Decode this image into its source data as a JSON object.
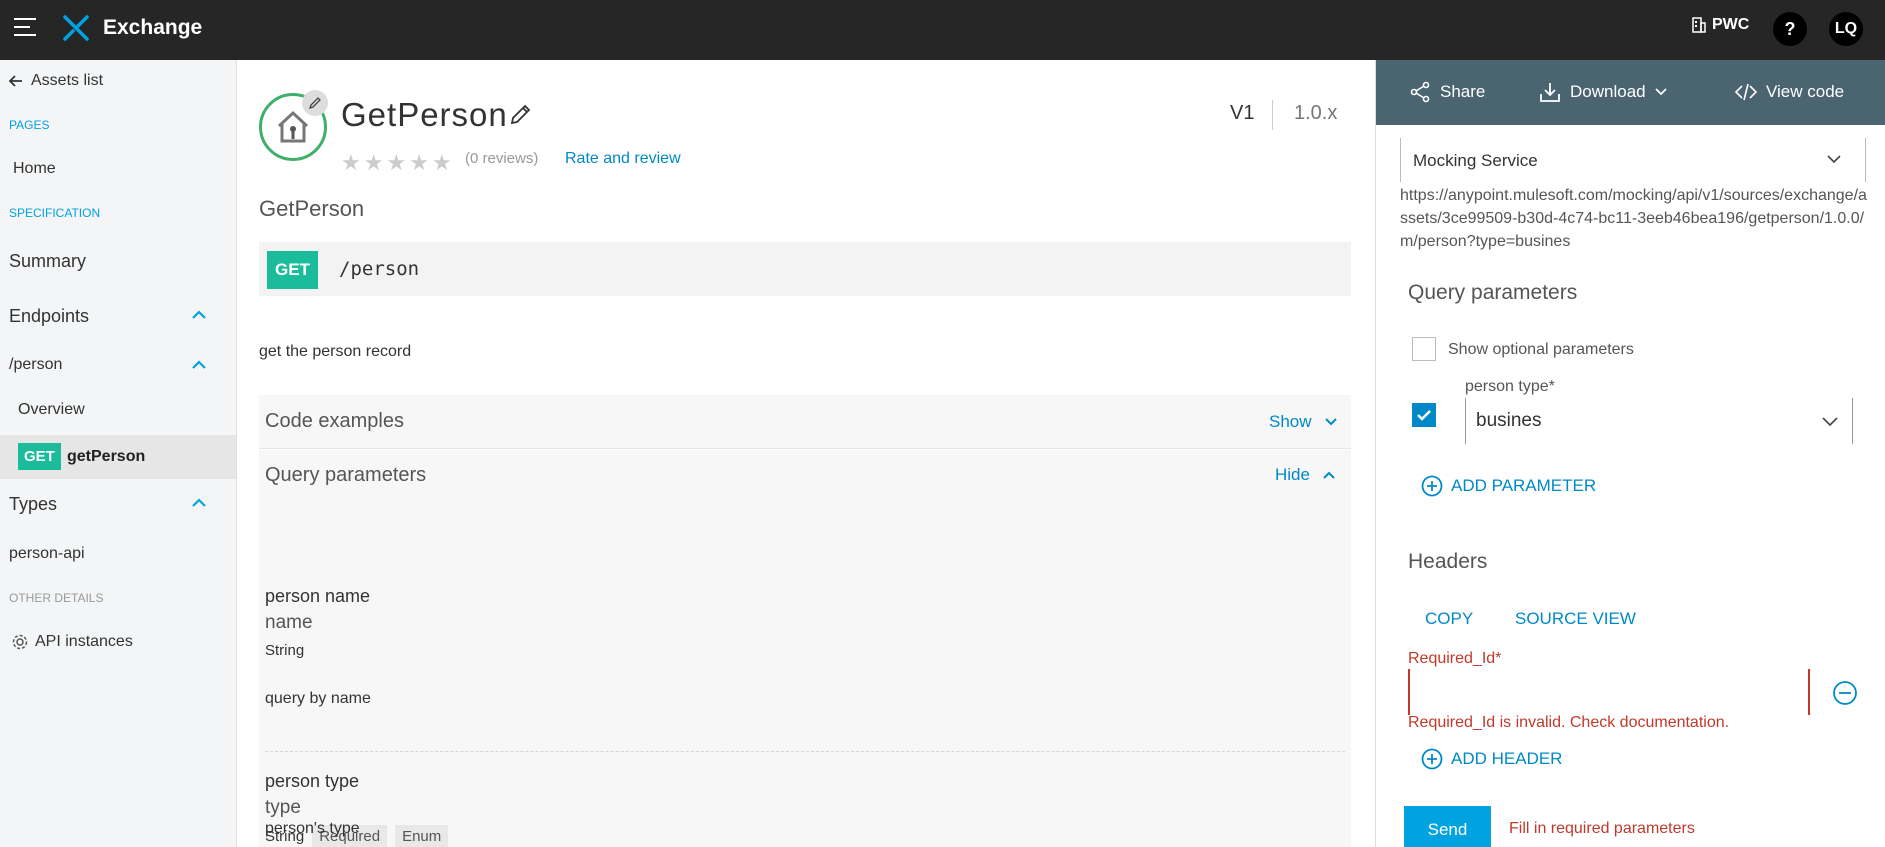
{
  "topbar": {
    "brand": "Exchange",
    "org": "PWC",
    "help": "?",
    "avatar": "LQ",
    "icons": {
      "menu": "hamburger-icon",
      "logo": "exchange-logo-icon",
      "org": "building-icon"
    }
  },
  "sidebar": {
    "back_label": "Assets list",
    "section_pages": "PAGES",
    "home": "Home",
    "section_spec": "SPECIFICATION",
    "summary": "Summary",
    "endpoints": "Endpoints",
    "person_path": "/person",
    "overview": "Overview",
    "method": "GET",
    "get_person": "getPerson",
    "types": "Types",
    "person_api": "person-api",
    "section_other": "OTHER DETAILS",
    "api_instances": "API instances"
  },
  "main": {
    "title": "GetPerson",
    "reviews": "(0 reviews)",
    "rate_link": "Rate and review",
    "version_major": "V1",
    "version_minor": "1.0.x",
    "heading": "GetPerson",
    "method": "GET",
    "path": "/person",
    "description": "get the person record",
    "code_examples": {
      "title": "Code examples",
      "toggle": "Show"
    },
    "query_params": {
      "title": "Query parameters",
      "toggle": "Hide"
    },
    "params": [
      {
        "name": "person name",
        "key": "name",
        "type": "String",
        "tags": [],
        "description": "query by name"
      },
      {
        "name": "person type",
        "key": "type",
        "type": "String",
        "tags": [
          "Required",
          "Enum"
        ],
        "description": "person's type"
      }
    ]
  },
  "console": {
    "toolbar": {
      "share": "Share",
      "download": "Download",
      "view_code": "View code"
    },
    "mock_service": "Mocking Service",
    "mock_url": "https://anypoint.mulesoft.com/mocking/api/v1/sources/exchange/assets/3ce99509-b30d-4c74-bc11-3eeb46bea196/getperson/1.0.0/m/person?type=busines",
    "query_heading": "Query parameters",
    "show_optional": "Show optional parameters",
    "person_type_label": "person type*",
    "person_type_value": "busines",
    "add_parameter": "ADD PARAMETER",
    "headers_heading": "Headers",
    "copy": "COPY",
    "source_view": "SOURCE VIEW",
    "required_label": "Required_Id*",
    "required_error": "Required_Id is invalid. Check documentation.",
    "add_header": "ADD HEADER",
    "send": "Send",
    "send_note": "Fill in required parameters"
  },
  "colors": {
    "topbar": "#262626",
    "accent": "#00a2df",
    "link": "#0089c8",
    "get": "#1abc9c",
    "error": "#c0392b",
    "toolbar": "#4a6470"
  }
}
